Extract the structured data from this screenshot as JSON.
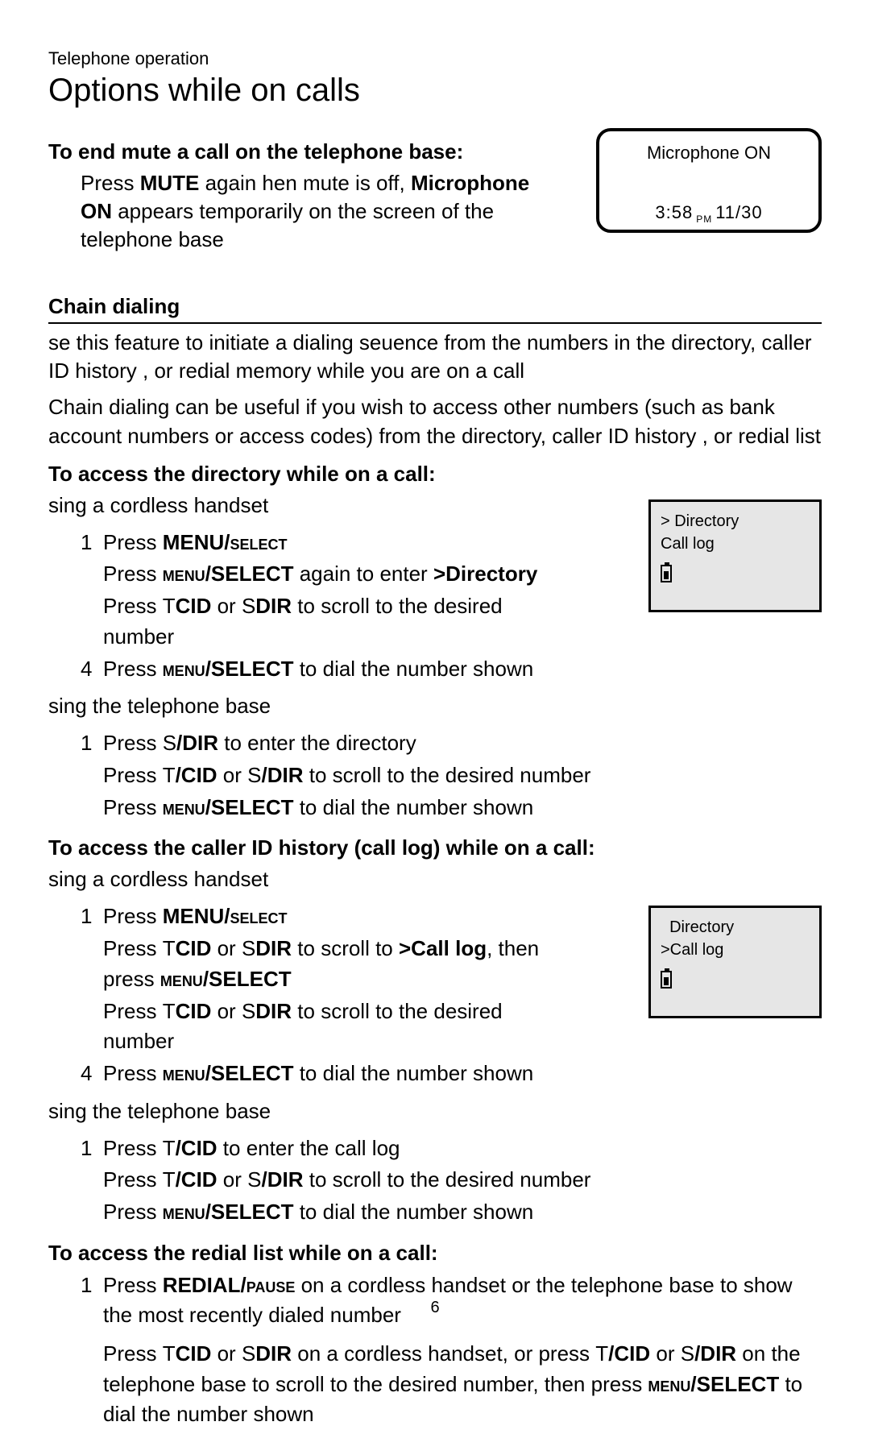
{
  "breadcrumb": "Telephone operation",
  "title": "Options while on calls",
  "s1": {
    "h": "To end mute a call on the telephone base:",
    "p_pre": "Press ",
    "p_mute": "MUTE",
    "p_mid": " again hen mute is off,      ",
    "p_micon": "Microphone ON",
    "p_tail": " appears temporarily on the screen of the telephone base"
  },
  "screen1": {
    "l1": "Microphone ON",
    "time": "3:58",
    "pm": "PM",
    "date": "11/30"
  },
  "chain": {
    "h": "Chain dialing",
    "p1": "se this feature to initiate a dialing seuence from the numbers in the directory, caller ID history  , or redial memory while you are on a call",
    "p2": "Chain dialing can be useful if you wish to access other numbers (such as bank account  numbers  or access codes) from the directory, caller ID history     , or redial list"
  },
  "dir": {
    "h": "To access the directory while on a call:",
    "sub1": "sing a cordless handset",
    "a1_n": "1",
    "a1_pre": "Press ",
    "a1_k": "MENU/",
    "a1_sc": "SELECT",
    "a2_pre": "Press ",
    "a2_sc": "MENU",
    "a2_k": "/SELECT",
    "a2_mid": " again to enter  ",
    "a2_b": ">Directory",
    "a3_pre": "Press  ",
    "a3_t": "T",
    "a3_cid": "CID",
    "a3_or": " or  ",
    "a3_s": "S",
    "a3_dir": "DIR",
    "a3_tail": " to scroll to the desired number",
    "a4_n": "4",
    "a4_pre": "Press ",
    "a4_sc": "MENU",
    "a4_k": "/SELECT",
    "a4_tail": " to dial  the number shown",
    "sub2": "sing the telephone base",
    "b1_n": "1",
    "b1_pre": "Press  ",
    "b1_s": "S",
    "b1_dir": "/DIR",
    "b1_tail": " to enter the directory",
    "b2_pre": "Press  ",
    "b2_t": "T",
    "b2_cid": "/CID",
    "b2_or": " or  ",
    "b2_s": "S",
    "b2_dir": "/DIR",
    "b2_tail": " to scroll to the desired number",
    "b3_pre": "Press ",
    "b3_sc": "MENU",
    "b3_k": "/SELECT",
    "b3_tail": " to dial  the number shown"
  },
  "screen2": {
    "l1": "> Directory",
    "l2": "Call log"
  },
  "calllog": {
    "h": "To access the caller ID history (call log) while on a call:",
    "sub1": "sing a cordless handset",
    "a1_n": "1",
    "a1_pre": "Press ",
    "a1_k": "MENU/",
    "a1_sc": "SELECT",
    "a2_pre": "Press  ",
    "a2_t": "T",
    "a2_cid": "CID",
    "a2_or": " or  ",
    "a2_s": "S",
    "a2_dir": "DIR",
    "a2_mid": " to scroll to  ",
    "a2_b": ">Call log",
    "a2_tail": ", then press ",
    "a2_sc2": "MENU",
    "a2_k2": "/SELECT",
    "a3_pre": "Press  ",
    "a3_t": "T",
    "a3_cid": "CID",
    "a3_or": " or  ",
    "a3_s": "S",
    "a3_dir": "DIR",
    "a3_tail": " to scroll to the desired number",
    "a4_n": "4",
    "a4_pre": "Press ",
    "a4_sc": "MENU",
    "a4_k": "/SELECT",
    "a4_tail": " to dial the number   shown",
    "sub2": "sing the telephone base",
    "b1_n": "1",
    "b1_pre": "Press  ",
    "b1_t": "T",
    "b1_cid": "/CID",
    "b1_tail": " to enter the call log",
    "b2_pre": "Press  ",
    "b2_t": "T",
    "b2_cid": "/CID",
    "b2_or": " or  ",
    "b2_s": "S",
    "b2_dir": "/DIR",
    "b2_tail": " to scroll to the desired number",
    "b3_pre": "Press ",
    "b3_sc": "MENU",
    "b3_k": "/SELECT",
    "b3_tail": " to dial  the number shown"
  },
  "screen3": {
    "l1": "  Directory",
    "l2": ">Call log"
  },
  "redial": {
    "h": "To access the redial list while on a call:",
    "a1_n": "1",
    "a1_pre": "Press ",
    "a1_k": "REDIAL/",
    "a1_sc": "PAUSE",
    "a1_tail": " on a cordless handset or the telephone base to show the most recently dialed number",
    "a2_pre": "Press  ",
    "a2_t": "T",
    "a2_cid": "CID",
    "a2_or": " or  ",
    "a2_s": "S",
    "a2_dir": "DIR",
    "a2_mid": " on a cordless handset, or press     ",
    "a2_t2": "T",
    "a2_cid2": "/CID",
    "a2_or2": " or  ",
    "a2_s2": "S",
    "a2_dir2": "/DIR",
    "a2_tail": " on the telephone base to scroll to the desired number, then press      ",
    "a2_sc": "MENU",
    "a2_k": "/SELECT",
    "a2_end": " to dial the number shown"
  },
  "pagenum": "6"
}
